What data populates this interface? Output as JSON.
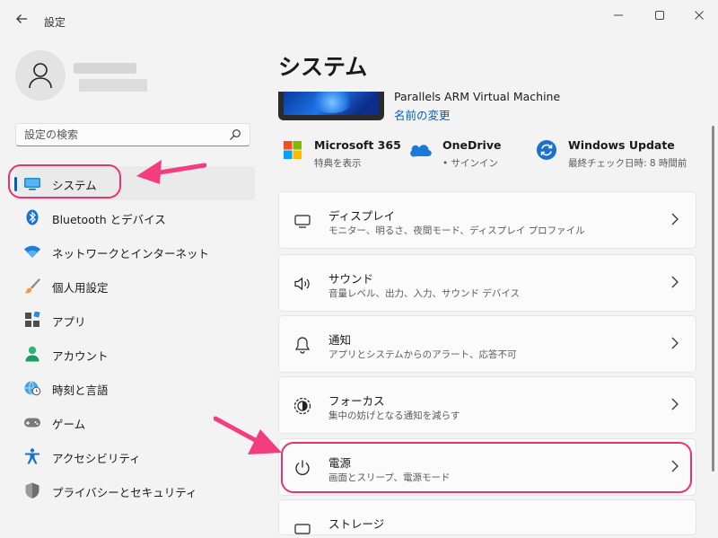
{
  "window": {
    "title": "設定",
    "back_icon": "arrow-left-icon",
    "controls": [
      "minimize",
      "maximize",
      "close"
    ]
  },
  "search": {
    "placeholder": "設定の検索"
  },
  "nav": {
    "items": [
      {
        "label": "システム",
        "icon": "display-icon",
        "active": true
      },
      {
        "label": "Bluetooth とデバイス",
        "icon": "bluetooth-icon"
      },
      {
        "label": "ネットワークとインターネット",
        "icon": "wifi-icon"
      },
      {
        "label": "個人用設定",
        "icon": "brush-icon"
      },
      {
        "label": "アプリ",
        "icon": "apps-icon"
      },
      {
        "label": "アカウント",
        "icon": "account-icon"
      },
      {
        "label": "時刻と言語",
        "icon": "clock-globe-icon"
      },
      {
        "label": "ゲーム",
        "icon": "gamepad-icon"
      },
      {
        "label": "アクセシビリティ",
        "icon": "accessibility-icon"
      },
      {
        "label": "プライバシーとセキュリティ",
        "icon": "shield-icon"
      }
    ]
  },
  "main": {
    "title": "システム",
    "device": {
      "name": "Parallels ARM Virtual Machine",
      "rename": "名前の変更"
    },
    "quick": [
      {
        "title": "Microsoft 365",
        "subtitle": "特典を表示",
        "icon": "microsoft-icon"
      },
      {
        "title": "OneDrive",
        "subtitle": "• サインイン",
        "icon": "onedrive-icon"
      },
      {
        "title": "Windows Update",
        "subtitle": "最終チェック日時: 8 時間前",
        "icon": "windows-update-icon"
      }
    ],
    "cards": [
      {
        "title": "ディスプレイ",
        "subtitle": "モニター、明るさ、夜間モード、ディスプレイ プロファイル",
        "icon": "monitor-icon"
      },
      {
        "title": "サウンド",
        "subtitle": "音量レベル、出力、入力、サウンド デバイス",
        "icon": "speaker-icon"
      },
      {
        "title": "通知",
        "subtitle": "アプリとシステムからのアラート、応答不可",
        "icon": "bell-icon"
      },
      {
        "title": "フォーカス",
        "subtitle": "集中の妨げとなる通知を減らす",
        "icon": "focus-icon"
      },
      {
        "title": "電源",
        "subtitle": "画面とスリープ、電源モード",
        "icon": "power-icon"
      },
      {
        "title": "ストレージ",
        "subtitle": "",
        "icon": "storage-icon"
      }
    ]
  },
  "colors": {
    "accent": "#005fb8",
    "annotation": "#e83372"
  }
}
